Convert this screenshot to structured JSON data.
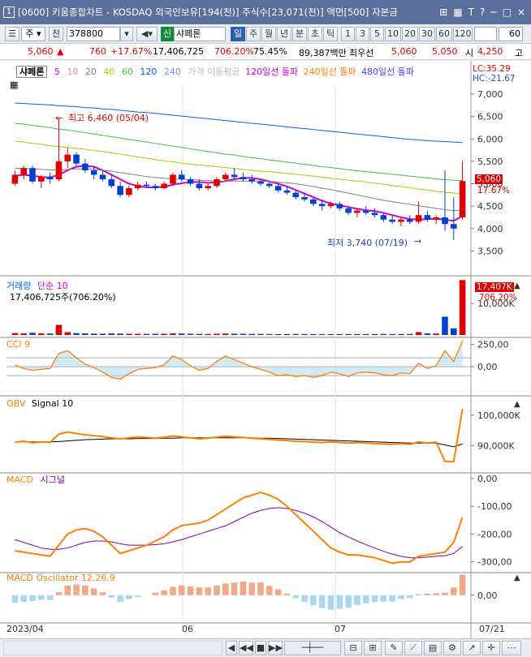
{
  "window": {
    "number": "1",
    "title": "[0600] 키움종합차트 - KOSDAQ 외국인보유[194(천)] 주식수[23,071(천)] 액면[500] 자본금",
    "controls": [
      "⊞",
      "▦",
      "T",
      "?",
      "─",
      "□",
      "×"
    ]
  },
  "toolbar": {
    "period_label": "주",
    "type_label": "전",
    "code": "378800",
    "sin_badge": "신",
    "stock_name": "샤페론",
    "intervals": [
      "일",
      "주",
      "월",
      "년",
      "분",
      "초",
      "틱"
    ],
    "selected_interval": "일",
    "minutes": [
      "1",
      "3",
      "5",
      "10",
      "20",
      "30",
      "60",
      "120"
    ],
    "count": "60"
  },
  "quote": {
    "price": "5,060",
    "arrow": "▲",
    "change": "760",
    "change_pct": "+17.67%",
    "volume": "17,406,725",
    "volume_pct": "706.20%",
    "ratio": "75.45%",
    "amount": "89,387백만",
    "best_label": "최우선",
    "ask": "5,060",
    "bid": "5,050",
    "open_label": "시",
    "open": "4,250",
    "high_label": "고"
  },
  "legend": {
    "stock": "샤페론",
    "ma": [
      "5",
      "10",
      "20",
      "40",
      "60",
      "120",
      "240"
    ],
    "ma_colors": [
      "#d000d0",
      "#ff8080",
      "#808080",
      "#c0c000",
      "#40c040",
      "#0060ff",
      "#8080ff"
    ],
    "price_ma": "가격 이동평균",
    "break120": "120일선 돌파",
    "break240": "240일선 돌파",
    "break480": "480일선 돌파",
    "lc": "LC:35.29",
    "hc": "HC:-21.67"
  },
  "annotations": {
    "high": "최고 6,460 (05/04)",
    "low": "최저 3,740 (07/19)",
    "last_price": "5,060",
    "last_pct": "17.67%",
    "vol_tag": "17,407K",
    "vol_pct": "706.20%"
  },
  "volume_panel": {
    "title": "거래량",
    "sub": "단순 10",
    "value": "17,406,725주(706.20%)"
  },
  "cci_panel": {
    "title": "CCI 9"
  },
  "obv_panel": {
    "title": "OBV",
    "sub": "Signal 10"
  },
  "macd_panel": {
    "title": "MACD",
    "sub": "시그널"
  },
  "osc_panel": {
    "title": "MACD Oscillator 12,26,9"
  },
  "xaxis": [
    "2023/04",
    "06",
    "07",
    "07/21"
  ],
  "chart_data": [
    {
      "type": "candlestick",
      "title": "샤페론",
      "y_ticks": [
        "7,000",
        "6,500",
        "6,000",
        "5,500",
        "5,000",
        "4,500",
        "4,000",
        "3,500"
      ],
      "ylim": [
        3000,
        7200
      ],
      "ohlc": [
        [
          5000,
          5300,
          4950,
          5200
        ],
        [
          5200,
          5400,
          5100,
          5350
        ],
        [
          5350,
          5400,
          5000,
          5050
        ],
        [
          5050,
          5200,
          4900,
          5150
        ],
        [
          5150,
          5250,
          5000,
          5100
        ],
        [
          5100,
          6460,
          5050,
          5500
        ],
        [
          5500,
          5800,
          5350,
          5650
        ],
        [
          5650,
          5700,
          5400,
          5450
        ],
        [
          5450,
          5550,
          5250,
          5300
        ],
        [
          5300,
          5400,
          5100,
          5200
        ],
        [
          5200,
          5300,
          5050,
          5100
        ],
        [
          5100,
          5200,
          4900,
          4950
        ],
        [
          4950,
          5050,
          4700,
          4750
        ],
        [
          4750,
          4950,
          4700,
          4900
        ],
        [
          4900,
          5050,
          4850,
          4980
        ],
        [
          4980,
          5050,
          4900,
          4950
        ],
        [
          4950,
          5000,
          4850,
          4900
        ],
        [
          4900,
          5050,
          4880,
          5000
        ],
        [
          5000,
          5250,
          4950,
          5200
        ],
        [
          5200,
          5300,
          5050,
          5100
        ],
        [
          5100,
          5150,
          4950,
          5000
        ],
        [
          5000,
          5100,
          4850,
          4900
        ],
        [
          4900,
          5000,
          4850,
          4950
        ],
        [
          4950,
          5150,
          4900,
          5100
        ],
        [
          5100,
          5250,
          5050,
          5200
        ],
        [
          5200,
          5350,
          5100,
          5150
        ],
        [
          5150,
          5250,
          5050,
          5100
        ],
        [
          5100,
          5200,
          5000,
          5050
        ],
        [
          5050,
          5100,
          4950,
          5000
        ],
        [
          5000,
          5050,
          4900,
          4950
        ],
        [
          4950,
          5000,
          4800,
          4850
        ],
        [
          4850,
          4950,
          4750,
          4800
        ],
        [
          4800,
          4850,
          4650,
          4700
        ],
        [
          4700,
          4800,
          4600,
          4650
        ],
        [
          4650,
          4700,
          4500,
          4550
        ],
        [
          4550,
          4650,
          4400,
          4500
        ],
        [
          4500,
          4600,
          4450,
          4550
        ],
        [
          4550,
          4600,
          4400,
          4450
        ],
        [
          4450,
          4500,
          4300,
          4350
        ],
        [
          4350,
          4450,
          4250,
          4400
        ],
        [
          4400,
          4500,
          4300,
          4350
        ],
        [
          4350,
          4450,
          4250,
          4300
        ],
        [
          4300,
          4350,
          4150,
          4200
        ],
        [
          4200,
          4300,
          4100,
          4150
        ],
        [
          4150,
          4250,
          4050,
          4200
        ],
        [
          4200,
          4300,
          4100,
          4150
        ],
        [
          4150,
          4600,
          4100,
          4300
        ],
        [
          4300,
          4400,
          4150,
          4200
        ],
        [
          4200,
          4300,
          4100,
          4250
        ],
        [
          4250,
          5300,
          3950,
          4100
        ],
        [
          4100,
          4700,
          3740,
          4000
        ],
        [
          4250,
          5500,
          4200,
          5060
        ]
      ],
      "ma_series": [
        {
          "name": "5",
          "color": "#d000d0",
          "values": [
            5180,
            5200,
            5180,
            5150,
            5140,
            5200,
            5300,
            5380,
            5400,
            5380,
            5300,
            5200,
            5100,
            5000,
            4950,
            4920,
            4920,
            4930,
            4980,
            5010,
            5040,
            5040,
            5020,
            5030,
            5060,
            5100,
            5130,
            5130,
            5100,
            5050,
            5000,
            4940,
            4860,
            4780,
            4700,
            4620,
            4560,
            4520,
            4480,
            4440,
            4410,
            4390,
            4350,
            4300,
            4250,
            4210,
            4200,
            4210,
            4220,
            4200,
            4170,
            4280
          ]
        },
        {
          "name": "20",
          "color": "#808080",
          "values": [
            5350,
            5340,
            5330,
            5320,
            5310,
            5310,
            5320,
            5330,
            5330,
            5320,
            5300,
            5280,
            5250,
            5220,
            5190,
            5160,
            5140,
            5120,
            5110,
            5100,
            5090,
            5080,
            5070,
            5060,
            5060,
            5060,
            5060,
            5060,
            5060,
            5050,
            5040,
            5020,
            5000,
            4970,
            4940,
            4900,
            4870,
            4830,
            4790,
            4750,
            4710,
            4670,
            4630,
            4600,
            4570,
            4540,
            4510,
            4480,
            4450,
            4420,
            4400,
            4410
          ]
        },
        {
          "name": "40",
          "color": "#c0c000",
          "values": [
            5950,
            5930,
            5900,
            5880,
            5850,
            5830,
            5810,
            5790,
            5770,
            5740,
            5720,
            5690,
            5660,
            5630,
            5600,
            5570,
            5540,
            5510,
            5490,
            5460,
            5440,
            5420,
            5400,
            5380,
            5360,
            5340,
            5320,
            5300,
            5280,
            5270,
            5250,
            5230,
            5210,
            5190,
            5170,
            5150,
            5120,
            5100,
            5080,
            5060,
            5040,
            5010,
            4990,
            4960,
            4940,
            4910,
            4880,
            4860,
            4830,
            4810,
            4790,
            4780
          ]
        },
        {
          "name": "60",
          "color": "#40c040",
          "values": [
            6350,
            6330,
            6300,
            6280,
            6250,
            6220,
            6200,
            6170,
            6140,
            6110,
            6080,
            6050,
            6020,
            5990,
            5960,
            5930,
            5900,
            5870,
            5840,
            5810,
            5780,
            5750,
            5720,
            5690,
            5660,
            5640,
            5610,
            5580,
            5560,
            5530,
            5510,
            5480,
            5460,
            5430,
            5410,
            5380,
            5360,
            5340,
            5310,
            5290,
            5270,
            5250,
            5230,
            5210,
            5190,
            5170,
            5150,
            5130,
            5110,
            5090,
            5080,
            5070
          ]
        },
        {
          "name": "120",
          "color": "#0060ff",
          "values": [
            6800,
            6790,
            6780,
            6770,
            6760,
            6740,
            6730,
            6720,
            6700,
            6690,
            6670,
            6660,
            6640,
            6620,
            6600,
            6590,
            6570,
            6550,
            6530,
            6510,
            6490,
            6470,
            6450,
            6430,
            6410,
            6390,
            6370,
            6350,
            6330,
            6310,
            6290,
            6270,
            6250,
            6230,
            6210,
            6190,
            6170,
            6150,
            6130,
            6110,
            6090,
            6070,
            6050,
            6030,
            6010,
            5990,
            5980,
            5960,
            5950,
            5940,
            5930,
            5920
          ]
        }
      ]
    },
    {
      "type": "bar",
      "title": "거래량",
      "y_ticks": [
        "10,000K"
      ],
      "ylim": [
        0,
        18000
      ],
      "values": [
        600,
        500,
        700,
        500,
        450,
        3200,
        900,
        600,
        500,
        450,
        400,
        500,
        450,
        400,
        380,
        350,
        380,
        400,
        500,
        450,
        380,
        350,
        330,
        400,
        450,
        420,
        380,
        350,
        330,
        320,
        300,
        310,
        330,
        310,
        300,
        290,
        280,
        300,
        310,
        290,
        300,
        310,
        330,
        300,
        320,
        340,
        900,
        500,
        450,
        5800,
        2100,
        17407
      ]
    },
    {
      "type": "line",
      "title": "CCI 9",
      "y_ticks": [
        "250,00",
        "0,00"
      ],
      "ylim": [
        -300,
        320
      ],
      "series": [
        {
          "name": "CCI 9",
          "values": [
            20,
            -20,
            -40,
            -30,
            -20,
            150,
            180,
            100,
            30,
            -10,
            -60,
            -120,
            -140,
            -80,
            -30,
            -20,
            -10,
            20,
            120,
            80,
            10,
            -40,
            -20,
            60,
            120,
            80,
            40,
            0,
            -30,
            -60,
            -100,
            -90,
            -110,
            -100,
            -120,
            -100,
            -60,
            -80,
            -110,
            -70,
            -60,
            -70,
            -90,
            -100,
            -70,
            -80,
            40,
            -20,
            10,
            180,
            60,
            290
          ]
        }
      ]
    },
    {
      "type": "line",
      "title": "OBV",
      "y_ticks": [
        "100,000K",
        "90,000K"
      ],
      "ylim": [
        82000,
        106000
      ],
      "series": [
        {
          "name": "OBV",
          "values": [
            91200,
            91500,
            91000,
            91300,
            91100,
            93800,
            94500,
            94000,
            93600,
            93300,
            93000,
            92600,
            92300,
            92600,
            92900,
            92700,
            92500,
            92800,
            93200,
            92900,
            92600,
            92300,
            92500,
            92800,
            93100,
            92900,
            92700,
            92500,
            92300,
            92100,
            91900,
            91700,
            91500,
            91400,
            91200,
            91100,
            91300,
            91100,
            90900,
            91100,
            90900,
            90700,
            90600,
            90500,
            90700,
            90500,
            91300,
            90900,
            91200,
            85000,
            84800,
            102000
          ]
        },
        {
          "name": "Signal 10",
          "values": [
            91300,
            91300,
            91300,
            91300,
            91300,
            91400,
            91600,
            91800,
            92000,
            92100,
            92200,
            92300,
            92300,
            92300,
            92400,
            92400,
            92400,
            92500,
            92500,
            92600,
            92600,
            92600,
            92600,
            92600,
            92600,
            92600,
            92600,
            92600,
            92500,
            92500,
            92400,
            92300,
            92200,
            92100,
            92000,
            91900,
            91800,
            91700,
            91600,
            91500,
            91400,
            91300,
            91200,
            91100,
            91000,
            90900,
            90900,
            90900,
            90900,
            90300,
            89700,
            90600
          ]
        }
      ]
    },
    {
      "type": "line",
      "title": "MACD",
      "y_ticks": [
        "0,00",
        "-100,00",
        "-200,00",
        "-300,00"
      ],
      "ylim": [
        -330,
        20
      ],
      "series": [
        {
          "name": "MACD",
          "values": [
            -260,
            -265,
            -270,
            -275,
            -280,
            -240,
            -200,
            -185,
            -180,
            -190,
            -210,
            -240,
            -270,
            -260,
            -250,
            -240,
            -225,
            -210,
            -185,
            -170,
            -165,
            -160,
            -150,
            -130,
            -110,
            -90,
            -70,
            -60,
            -50,
            -60,
            -75,
            -100,
            -130,
            -160,
            -190,
            -220,
            -250,
            -265,
            -275,
            -275,
            -280,
            -285,
            -295,
            -305,
            -300,
            -300,
            -280,
            -275,
            -270,
            -265,
            -230,
            -140
          ]
        },
        {
          "name": "시그널",
          "values": [
            -220,
            -230,
            -240,
            -250,
            -255,
            -255,
            -250,
            -240,
            -230,
            -225,
            -225,
            -228,
            -235,
            -240,
            -240,
            -240,
            -238,
            -235,
            -228,
            -220,
            -210,
            -200,
            -190,
            -180,
            -170,
            -155,
            -140,
            -125,
            -115,
            -108,
            -105,
            -108,
            -115,
            -125,
            -138,
            -155,
            -175,
            -195,
            -210,
            -225,
            -238,
            -250,
            -262,
            -272,
            -280,
            -285,
            -285,
            -283,
            -280,
            -278,
            -270,
            -245
          ]
        }
      ]
    },
    {
      "type": "bar",
      "title": "MACD Oscillator 12,26,9",
      "y_ticks": [
        "0,00"
      ],
      "ylim": [
        -130,
        120
      ],
      "values": [
        -40,
        -35,
        -30,
        -25,
        -25,
        15,
        50,
        55,
        50,
        35,
        15,
        -12,
        -35,
        -20,
        -10,
        0,
        13,
        25,
        43,
        50,
        45,
        40,
        40,
        50,
        60,
        65,
        70,
        65,
        65,
        48,
        30,
        8,
        -15,
        -35,
        -52,
        -65,
        -75,
        -70,
        -65,
        -50,
        -42,
        -35,
        -33,
        -33,
        -20,
        -15,
        5,
        8,
        10,
        13,
        40,
        105
      ]
    }
  ]
}
